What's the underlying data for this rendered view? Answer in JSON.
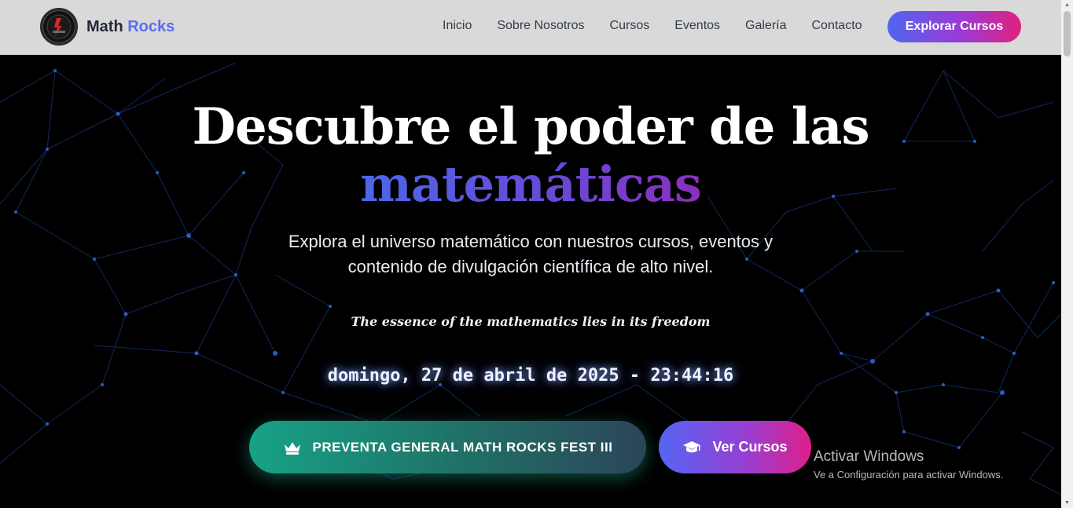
{
  "navbar": {
    "brand_main": "Math",
    "brand_accent": "Rocks",
    "links": [
      "Inicio",
      "Sobre Nosotros",
      "Cursos",
      "Eventos",
      "Galería",
      "Contacto"
    ],
    "cta": "Explorar Cursos"
  },
  "hero": {
    "title_line1": "Descubre el poder de las",
    "title_line2": "matemáticas",
    "subtitle": "Explora el universo matemático con nuestros cursos, eventos y contenido de divulgación científica de alto nivel.",
    "quote": "The essence of the mathematics lies in its freedom",
    "clock": "domingo, 27 de abril de 2025 - 23:44:16",
    "btn_presale": "PREVENTA GENERAL MATH ROCKS FEST III",
    "btn_courses": "Ver Cursos"
  },
  "watermark": {
    "title": "Activar Windows",
    "subtitle": "Ve a Configuración para activar Windows."
  },
  "icons": {
    "presale": "crown-icon",
    "courses": "graduation-cap-icon",
    "logo": "math-rocks-logo"
  },
  "colors": {
    "accent_blue": "#5b6cf2",
    "accent_pink": "#e0217c",
    "teal": "#17a287",
    "network_blue": "#2b5fd0"
  }
}
